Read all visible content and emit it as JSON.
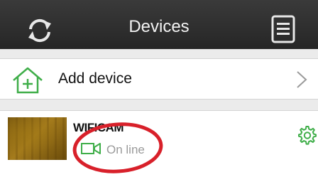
{
  "header": {
    "title": "Devices",
    "left_icon": "refresh-icon",
    "right_icon": "list-menu-icon"
  },
  "add_device": {
    "label": "Add device",
    "icon": "add-house-icon",
    "chevron": "chevron-right-icon"
  },
  "device": {
    "name": "WIFICAM",
    "status": "On line",
    "status_icon": "video-camera-icon",
    "settings_icon": "gear-icon"
  },
  "colors": {
    "header_bg": "#2e2e2e",
    "accent_green": "#3fae49",
    "annotation_red": "#d8202a"
  }
}
